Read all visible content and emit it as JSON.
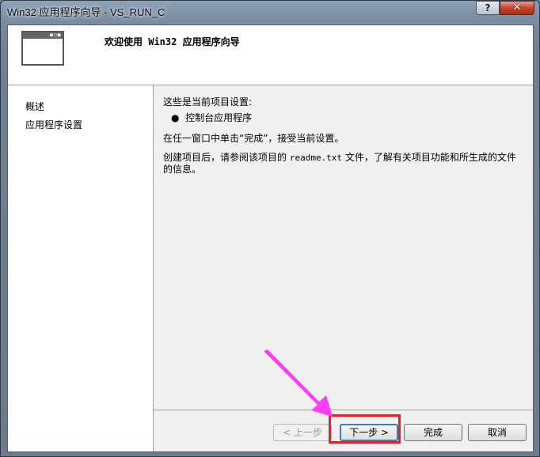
{
  "window": {
    "title": "Win32 应用程序向导 - VS_RUN_C",
    "help_label": "?",
    "close_label": "✕"
  },
  "header": {
    "title": "欢迎使用 Win32 应用程序向导",
    "icon": "window-icon"
  },
  "sidebar": {
    "items": [
      {
        "label": "概述"
      },
      {
        "label": "应用程序设置"
      }
    ]
  },
  "content": {
    "line1": "这些是当前项目设置:",
    "bullet": "控制台应用程序",
    "line3": "在任一窗口中单击“完成”，接受当前设置。",
    "line4_pre": "创建项目后，请参阅该项目的 ",
    "line4_file": "readme.txt",
    "line4_post": " 文件，了解有关项目功能和所生成的文件的信息。"
  },
  "buttons": {
    "back": "< 上一步",
    "next": "下一步 >",
    "finish": "完成",
    "cancel": "取消"
  },
  "annotation": {
    "arrow_color": "#ff3df5",
    "box_color": "#e3232c"
  }
}
